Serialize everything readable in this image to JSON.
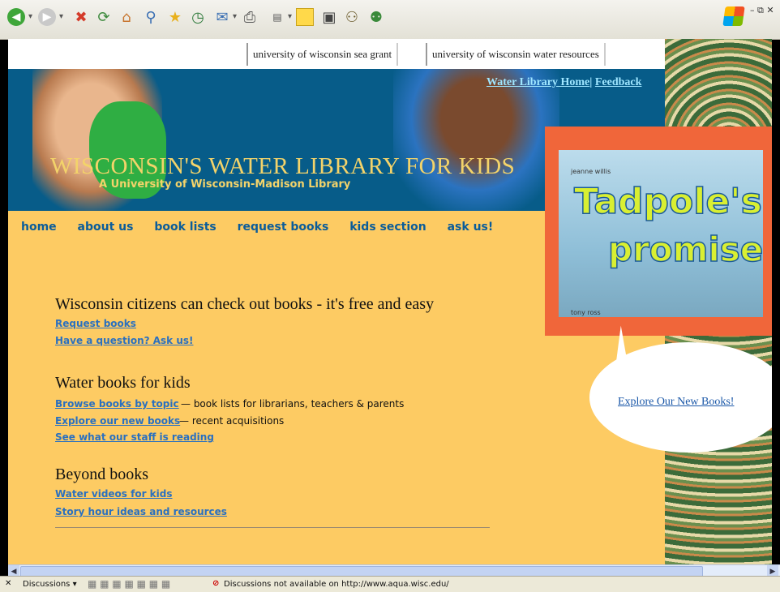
{
  "toolbar": {
    "icons": [
      "back-icon",
      "forward-icon",
      "stop-icon",
      "refresh-icon",
      "home-icon",
      "search-icon",
      "favorites-icon",
      "history-icon",
      "mail-icon",
      "print-icon",
      "edit-icon",
      "note-icon",
      "research-icon",
      "messenger-icon",
      "contacts-icon"
    ]
  },
  "header_links": {
    "sea_grant": "university of wisconsin sea grant",
    "water_resources": "university of wisconsin water resources"
  },
  "banner": {
    "title": "WISCONSIN'S WATER LIBRARY FOR KIDS",
    "subtitle": "A University of Wisconsin-Madison Library",
    "home_link": "Water Library Home",
    "separator": "|",
    "feedback_link": "Feedback"
  },
  "nav": [
    "home",
    "about us",
    "book lists",
    "request books",
    "kids section",
    "ask us!"
  ],
  "feature": {
    "book_author": "jeanne willis",
    "book_title_1": "Tadpole's",
    "book_title_2": "promise",
    "book_illustrator": "tony ross",
    "bubble_link": "Explore Our New Books!"
  },
  "sections": {
    "s1": {
      "heading": "Wisconsin citizens can check out books - it's free and easy",
      "link1": "Request books",
      "link2": "Have a question? Ask us!"
    },
    "s2": {
      "heading": "Water books for kids",
      "link1": "Browse books by topic ",
      "desc1": " — book lists for librarians, teachers & parents",
      "link2": "Explore our new books ",
      "desc2": " — recent acquisitions",
      "link3": "See what our staff is reading"
    },
    "s3": {
      "heading": "Beyond books",
      "link1": "Water videos for kids",
      "link2": "Story hour ideas and resources"
    }
  },
  "statusbar": {
    "close": "✕",
    "discussions": "Discussions ▾",
    "message": "Discussions not available on http://www.aqua.wisc.edu/"
  },
  "colors": {
    "page_bg": "#fdcb63",
    "banner_bg": "#075c89",
    "nav": "#0a5c9a",
    "link": "#2a70c0",
    "book_frame": "#f0663a"
  }
}
